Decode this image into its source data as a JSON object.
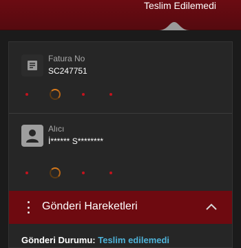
{
  "header": {
    "status_text": "Teslim Edilemedi",
    "bar_color": "#5e0a10"
  },
  "invoice": {
    "label": "Fatura No",
    "value": "SC247751",
    "icon": "receipt-icon"
  },
  "recipient": {
    "label": "Alıcı",
    "value": "İ****** S********",
    "icon": "person-icon"
  },
  "movements": {
    "title": "Gönderi Hareketleri",
    "header_color": "#6e0a10",
    "expanded": true
  },
  "bottom": {
    "label": "Gönderi Durumu:",
    "status_link": "Teslim edilemedi"
  },
  "colors": {
    "accent_red": "#c4131d",
    "link_blue": "#4fb3d9",
    "background": "#1b1b1b"
  }
}
